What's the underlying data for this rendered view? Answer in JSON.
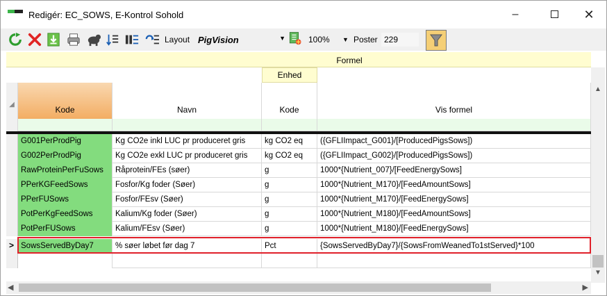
{
  "window": {
    "title": "Redigér: EC_SOWS, E-Kontrol Sohold",
    "minimize_glyph": "–",
    "close_glyph": "✕"
  },
  "toolbar": {
    "icons": [
      "refresh-icon",
      "delete-icon",
      "download-icon",
      "print-icon",
      "dog-icon",
      "sort-icon",
      "columns-icon",
      "group-icon",
      "export-icon",
      "filter-icon"
    ],
    "layout_label": "Layout",
    "layout_value": "PigVision",
    "zoom_value": "100%",
    "poster_label": "Poster",
    "poster_value": "229"
  },
  "grid": {
    "band_formel": "Formel",
    "band_enhed": "Enhed",
    "columns": [
      "Kode",
      "Navn",
      "Kode",
      "Vis formel"
    ],
    "rows": [
      {
        "kode": "G001PerProdPig",
        "navn": "Kg CO2e inkl LUC pr produceret gris",
        "enhed": "kg CO2 eq",
        "formel": "({GFLIImpact_G001}/[ProducedPigsSows])"
      },
      {
        "kode": "G002PerProdPig",
        "navn": "Kg CO2e exkl LUC pr produceret gris",
        "enhed": "kg CO2 eq",
        "formel": "({GFLIImpact_G002}/[ProducedPigsSows])"
      },
      {
        "kode": "RawProteinPerFuSows",
        "navn": "Råprotein/FEs (søer)",
        "enhed": "g",
        "formel": "1000*{Nutrient_007}/[FeedEnergySows]"
      },
      {
        "kode": "PPerKGFeedSows",
        "navn": "Fosfor/Kg foder (Søer)",
        "enhed": "g",
        "formel": "1000*{Nutrient_M170}/[FeedAmountSows]"
      },
      {
        "kode": "PPerFUSows",
        "navn": "Fosfor/FEsv (Søer)",
        "enhed": "g",
        "formel": "1000*{Nutrient_M170}/[FeedEnergySows]"
      },
      {
        "kode": "PotPerKgFeedSows",
        "navn": "Kalium/Kg foder (Søer)",
        "enhed": "g",
        "formel": "1000*{Nutrient_M180}/[FeedAmountSows]"
      },
      {
        "kode": "PotPerFUSows",
        "navn": "Kalium/FEsv (Søer)",
        "enhed": "g",
        "formel": "1000*{Nutrient_M180}/[FeedEnergySows]"
      },
      {
        "kode": "SowsServedByDay7",
        "navn": "% søer løbet før dag 7",
        "enhed": "Pct",
        "formel": "{SowsServedByDay7}/{SowsFromWeanedTo1stServed}*100"
      }
    ],
    "current_row_marker": ">"
  },
  "colors": {
    "kode_green": "#83dc7e",
    "header_yellow": "#fffdd0",
    "selection_red": "#e0202a",
    "filter_button": "#f5cf76"
  }
}
